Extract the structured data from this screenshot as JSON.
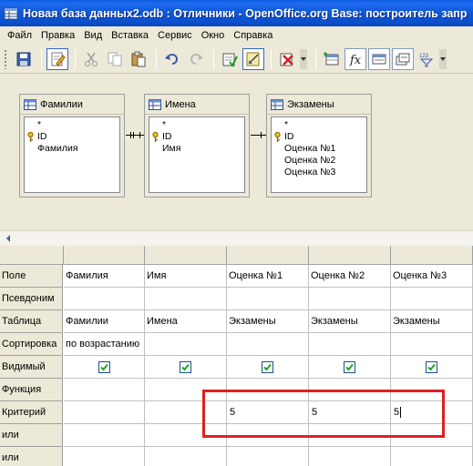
{
  "window": {
    "title": "Новая база данных2.odb : Отличники - OpenOffice.org Base: построитель запр"
  },
  "menu": [
    "Файл",
    "Правка",
    "Вид",
    "Вставка",
    "Сервис",
    "Окно",
    "Справка"
  ],
  "toolbar": {
    "buttons": [
      "save-icon",
      "edit-icon",
      "cut-icon",
      "copy-icon",
      "paste-icon",
      "undo-icon",
      "redo-icon",
      "run-query-icon",
      "design-view-icon",
      "clear-query-icon",
      "add-table-icon",
      "functions-icon",
      "table-name-icon",
      "alias-icon",
      "distinct-values-icon"
    ]
  },
  "tables": [
    {
      "name": "Фамилии",
      "fields": [
        "*",
        "ID",
        "Фамилия"
      ],
      "key_field": "ID"
    },
    {
      "name": "Имена",
      "fields": [
        "*",
        "ID",
        "Имя"
      ],
      "key_field": "ID"
    },
    {
      "name": "Экзамены",
      "fields": [
        "*",
        "ID",
        "Оценка №1",
        "Оценка №2",
        "Оценка №3"
      ],
      "key_field": "ID"
    }
  ],
  "grid": {
    "row_labels": [
      "Поле",
      "Псевдоним",
      "Таблица",
      "Сортировка",
      "Видимый",
      "Функция",
      "Критерий",
      "или",
      "или"
    ],
    "columns": [
      {
        "field": "Фамилия",
        "alias": "",
        "table": "Фамилии",
        "sort": "по возрастанию",
        "visible": true,
        "function": "",
        "criterion": "",
        "or1": "",
        "or2": ""
      },
      {
        "field": "Имя",
        "alias": "",
        "table": "Имена",
        "sort": "",
        "visible": true,
        "function": "",
        "criterion": "",
        "or1": "",
        "or2": ""
      },
      {
        "field": "Оценка №1",
        "alias": "",
        "table": "Экзамены",
        "sort": "",
        "visible": true,
        "function": "",
        "criterion": "5",
        "or1": "",
        "or2": ""
      },
      {
        "field": "Оценка №2",
        "alias": "",
        "table": "Экзамены",
        "sort": "",
        "visible": true,
        "function": "",
        "criterion": "5",
        "or1": "",
        "or2": ""
      },
      {
        "field": "Оценка №3",
        "alias": "",
        "table": "Экзамены",
        "sort": "",
        "visible": true,
        "function": "",
        "criterion": "5",
        "or1": "",
        "or2": ""
      }
    ]
  },
  "colors": {
    "title_bar": "#0b4fcc",
    "highlight": "#e02020",
    "checkbox": "#21a121"
  }
}
